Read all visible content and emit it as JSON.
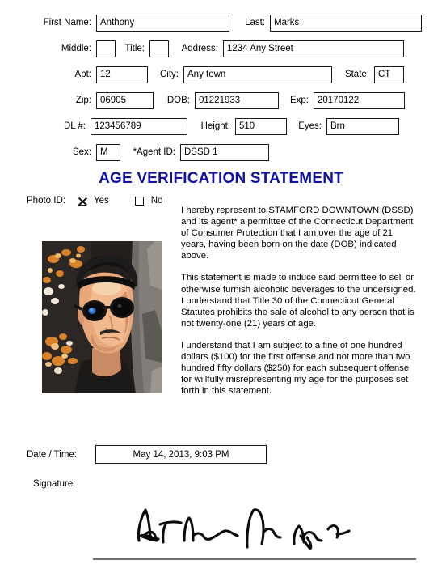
{
  "form": {
    "rows": [
      {
        "id": "name-row",
        "fields": [
          {
            "label": "First Name:",
            "value": "Anthony",
            "name": "first-name"
          },
          {
            "label": "Last:",
            "value": "Marks",
            "name": "last-name"
          }
        ]
      },
      {
        "id": "middle-row",
        "fields": [
          {
            "label": "Middle:",
            "value": "",
            "name": "middle-name"
          },
          {
            "label": "Title:",
            "value": "",
            "name": "title"
          },
          {
            "label": "Address:",
            "value": "1234 Any Street",
            "name": "address"
          }
        ]
      },
      {
        "id": "apt-row",
        "fields": [
          {
            "label": "Apt:",
            "value": "12",
            "name": "apt"
          },
          {
            "label": "City:",
            "value": "Any town",
            "name": "city"
          },
          {
            "label": "State:",
            "value": "CT",
            "name": "state"
          }
        ]
      },
      {
        "id": "zip-row",
        "fields": [
          {
            "label": "Zip:",
            "value": "06905",
            "name": "zip"
          },
          {
            "label": "DOB:",
            "value": "01221933",
            "name": "dob"
          },
          {
            "label": "Exp:",
            "value": "20170122",
            "name": "exp"
          }
        ]
      },
      {
        "id": "dl-row",
        "fields": [
          {
            "label": "DL #:",
            "value": "123456789",
            "name": "dl-number"
          },
          {
            "label": "Height:",
            "value": "510",
            "name": "height"
          },
          {
            "label": "Eyes:",
            "value": "Brn",
            "name": "eyes"
          }
        ]
      },
      {
        "id": "sex-row",
        "fields": [
          {
            "label": "Sex:",
            "value": "M",
            "name": "sex"
          },
          {
            "label": "*Agent ID:",
            "value": "DSSD 1",
            "name": "agent-id"
          }
        ]
      }
    ]
  },
  "heading": {
    "title": "AGE VERIFICATION STATEMENT",
    "color": "#1111a8"
  },
  "photo_id": {
    "label": "Photo ID:",
    "yes_label": "Yes",
    "no_label": "No",
    "yes_checked": true,
    "no_checked": false
  },
  "photo": {
    "alt": "photo-of-person",
    "description": "Portrait of a man wearing dark sunglasses and a dark cap, autumn foliage and rock background"
  },
  "statement": {
    "paragraphs": [
      "I hereby represent to STAMFORD DOWNTOWN (DSSD) and its agent* a permittee of the Connecticut Department of Consumer Protection that I am over the age of 21 years, having been born on the date (DOB) indicated above.",
      "This statement is made to induce said permittee to sell or otherwise furnish alcoholic beverages to the undersigned. I understand that Title 30 of the Connecticut General Statutes prohibits the sale of alcohol to any person that is not twenty-one (21) years of age.",
      "I understand that I am subject to a fine of one hundred dollars ($100) for the first offense and not more than two hundred fifty dollars ($250) for each subsequent offense for willfully misrepresenting my age  for the purposes set forth in this statement."
    ]
  },
  "datetime": {
    "label": "Date / Time:",
    "value": "May 14, 2013, 9:03 PM"
  },
  "signature": {
    "label": "Signature:"
  }
}
